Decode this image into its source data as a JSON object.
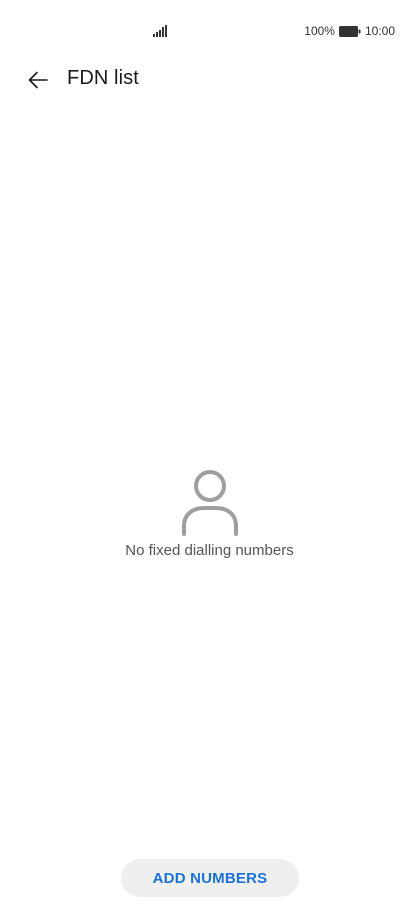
{
  "status_bar": {
    "battery_percent": "100%",
    "time": "10:00",
    "icons": [
      "signal-icon",
      "battery-icon"
    ]
  },
  "header": {
    "title": "FDN list",
    "back_icon": "arrow-left-icon"
  },
  "empty_state": {
    "icon": "person-icon",
    "message": "No fixed dialling numbers"
  },
  "footer": {
    "add_label": "ADD NUMBERS"
  },
  "colors": {
    "accent": "#1a73d9",
    "button_bg": "#efefef",
    "icon_gray": "#9e9e9e"
  }
}
